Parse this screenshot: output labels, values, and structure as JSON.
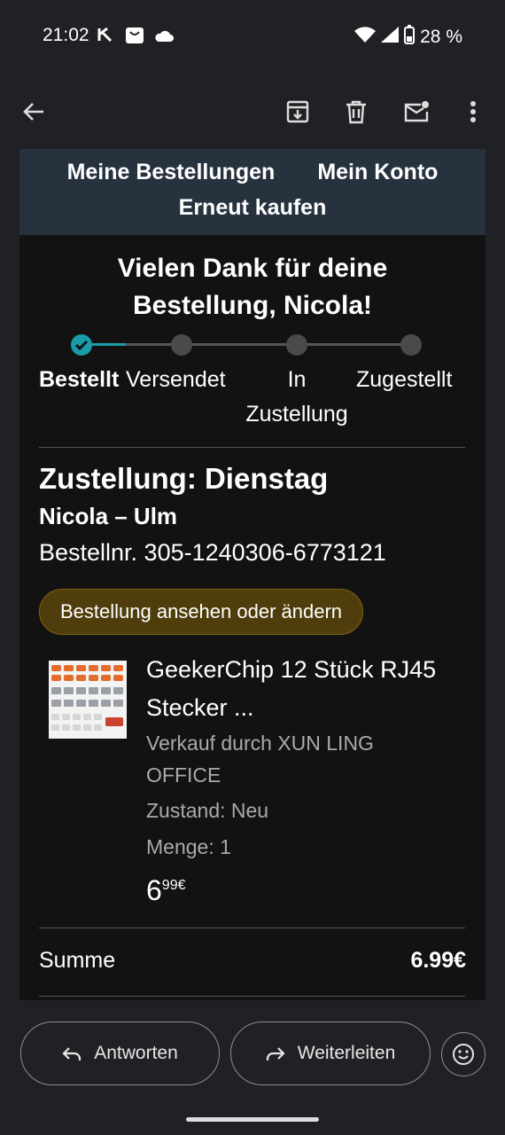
{
  "status_bar": {
    "time": "21:02",
    "battery": "28 %"
  },
  "email": {
    "nav": {
      "my_orders": "Meine Bestellungen",
      "my_account": "Mein Konto",
      "buy_again": "Erneut kaufen"
    },
    "thanks_line1": "Vielen Dank für deine",
    "thanks_line2": "Bestellung, Nicola!",
    "progress": {
      "steps": [
        "Bestellt",
        "Versendet",
        "In",
        "Zustellung",
        "Zugestellt"
      ],
      "current_step": 1
    },
    "delivery": "Zustellung: Dienstag",
    "recipient": "Nicola – Ulm",
    "order_number": "Bestellnr. 305-1240306-6773121",
    "view_button": "Bestellung ansehen oder ändern",
    "product": {
      "title": "GeekerChip 12 Stück RJ45 Stecker ...",
      "seller_line1": "Verkauf durch XUN LING",
      "seller_line2": "OFFICE",
      "condition": "Zustand: Neu",
      "quantity": "Menge: 1",
      "price_whole": "6",
      "price_fraction": "99€"
    },
    "sum": {
      "label": "Summe",
      "value": "6.99€"
    }
  },
  "actions": {
    "reply": "Antworten",
    "forward": "Weiterleiten"
  },
  "colors": {
    "accent": "#1a9ba8",
    "nav_band": "#27323f",
    "button_fill": "#4f3e0c"
  }
}
